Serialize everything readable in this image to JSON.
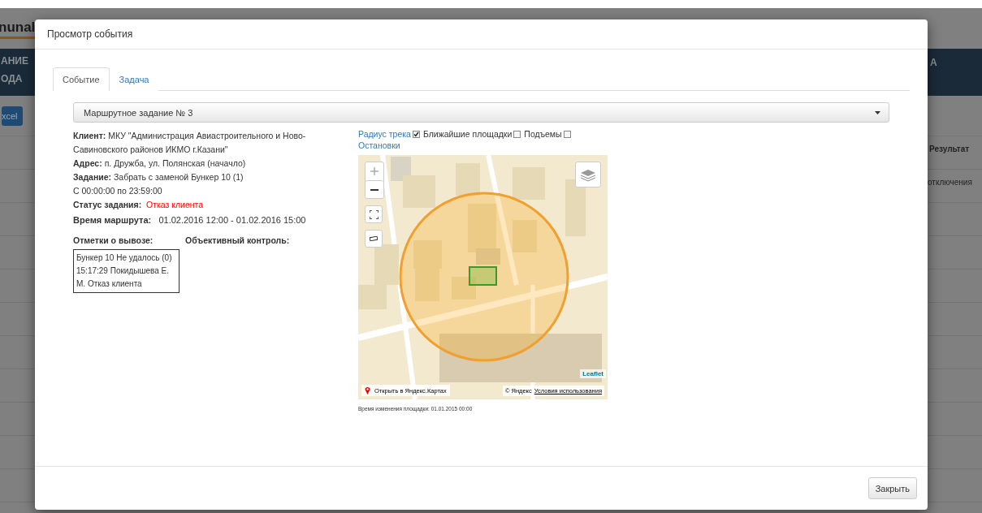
{
  "background": {
    "logo": "nunal",
    "nav": [
      "АНИЕ",
      "ОДА"
    ],
    "nav_right": "А",
    "export_button": "xcel",
    "table_header": "Результат",
    "first_row_result": "отключения"
  },
  "dialog": {
    "title": "Просмотр события",
    "tabs": [
      {
        "label": "Событие",
        "selected": true
      },
      {
        "label": "Задача",
        "selected": false
      }
    ],
    "route_select": {
      "value": "Маршрутное задание № 3"
    },
    "details": [
      {
        "kind": "field",
        "label": "Клиент:",
        "value": "МКУ \"Администрация Авиастроительного и Ново-Савиновского районов ИКМО г.Казани\""
      },
      {
        "kind": "field",
        "label": "Адрес:",
        "value": "п. Дружба, ул. Полянская (начачло)"
      },
      {
        "kind": "field",
        "label": "Задание:",
        "value": "Забрать с заменой Бункер 10 (1)"
      },
      {
        "kind": "plain",
        "value": "С 00:00:00 по 23:59:00"
      },
      {
        "kind": "status",
        "label": "Статус задания:",
        "value": "Отказ клиента"
      },
      {
        "kind": "time",
        "label": "Время маршрута:",
        "value": "01.02.2016 12:00 - 01.02.2016 15:00"
      }
    ],
    "marks_heading": "Отметки о вывозе:",
    "control_heading": "Объективный контроль:",
    "marks": [
      "Бункер 10 Не удалось (0)",
      "15:17:29 Покидышева Е.",
      "М. Отказ клиента"
    ],
    "layers": [
      {
        "label": "Радиус трека",
        "kind": "link",
        "checked": true
      },
      {
        "label": "Ближайшие площадки",
        "kind": "plain",
        "checked": false
      },
      {
        "label": "Подъемы",
        "kind": "plain",
        "checked": false
      },
      {
        "label": "Остановки",
        "kind": "link"
      }
    ],
    "map": {
      "attribution_link": "Leaflet",
      "open_link": "Открыть в Яндекс.Картах",
      "copyright": "© Яндекс",
      "terms_link": "Условия использования"
    },
    "site_changed": "Время изменения площадки: 01.01.2015 00:00",
    "close_button": "Закрыть"
  }
}
